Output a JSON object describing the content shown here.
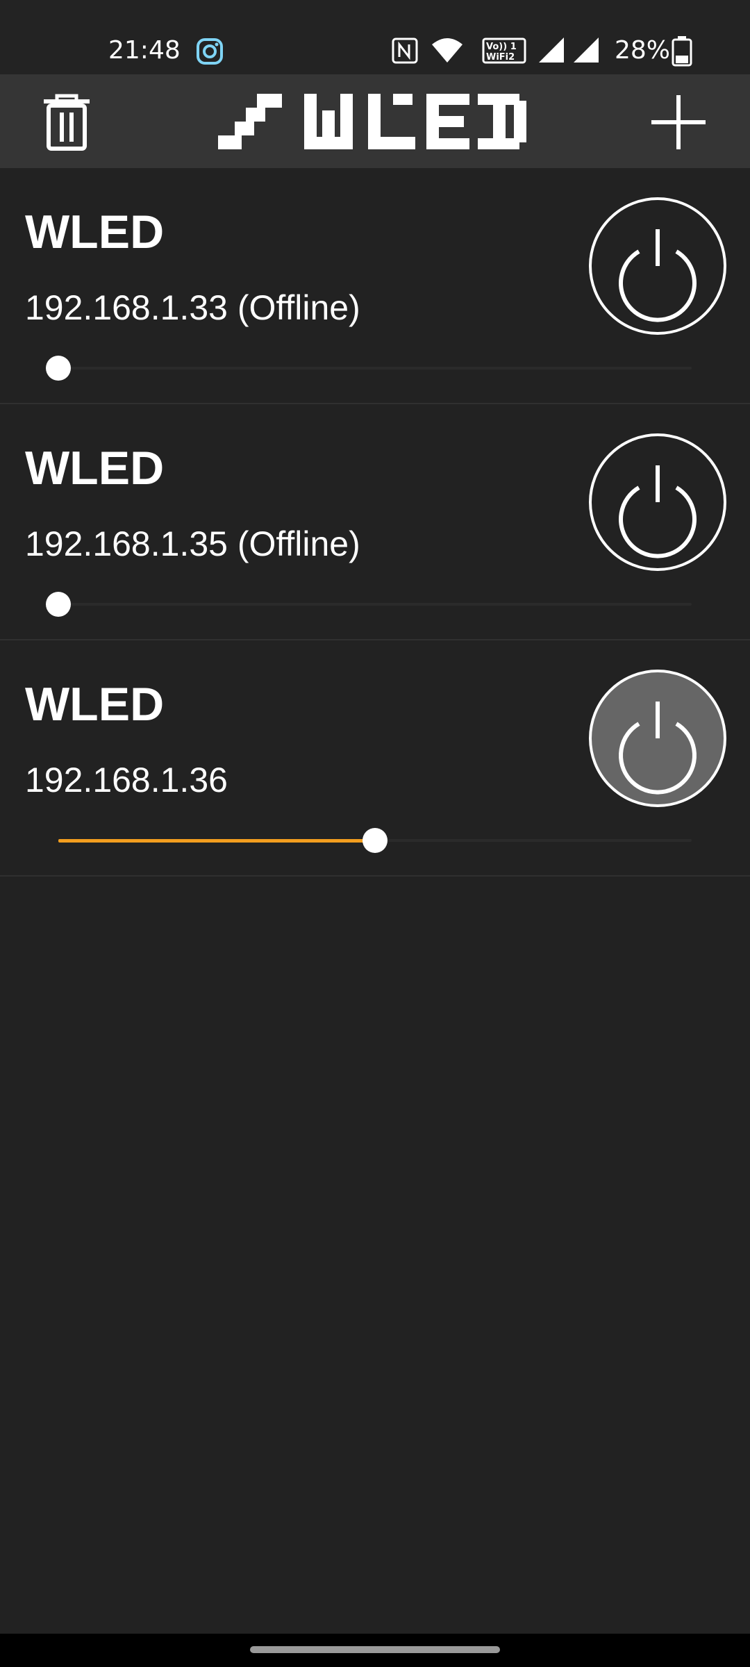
{
  "status_bar": {
    "time": "21:48",
    "battery": "28%",
    "icons": [
      "instagram-icon",
      "nfc-icon",
      "wifi-icon",
      "vowifi-icon",
      "signal-icon",
      "signal-icon",
      "battery-icon"
    ]
  },
  "app_bar": {
    "logo_text": "WLED",
    "left_icon": "trash-icon",
    "right_icon": "plus-icon"
  },
  "devices": [
    {
      "name": "WLED",
      "address": "192.168.1.33 (Offline)",
      "power_on": false,
      "brightness": 0.0
    },
    {
      "name": "WLED",
      "address": "192.168.1.35 (Offline)",
      "power_on": false,
      "brightness": 0.0
    },
    {
      "name": "WLED",
      "address": "192.168.1.36",
      "power_on": true,
      "brightness": 0.5
    }
  ],
  "colors": {
    "background": "#222222",
    "app_bar": "#353535",
    "accent": "#f29e1f",
    "power_on_fill": "#666666",
    "instagram_icon": "#7fd4f5"
  }
}
